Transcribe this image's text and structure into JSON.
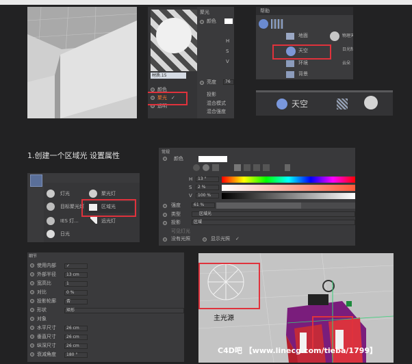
{
  "panel_viewport_1": {},
  "panel_material": {
    "name": "材质.15",
    "rows": [
      "颜色",
      "聚光",
      "透明"
    ],
    "checked": "✓"
  },
  "panel_light_props": {
    "title": "聚光",
    "color_label": "颜色",
    "h": "H",
    "s": "S",
    "v": "V",
    "brightness_label": "亮度",
    "brightness_value": "76",
    "project_label": "投影",
    "mix_label": "混合模式",
    "mix_strength": "混合强度"
  },
  "panel_menu": {
    "help": "帮助",
    "items": [
      "地面",
      "天空",
      "环境",
      "背景"
    ],
    "right_items": [
      "物理天空",
      "日光制工",
      "云朵"
    ]
  },
  "panel_sky_zoom": {
    "label": "天空"
  },
  "heading": "1.创建一个区域光 设置属性",
  "panel_light_menu": {
    "items": [
      "灯光",
      "目标聚光灯",
      "IES 灯...",
      "日光"
    ],
    "right_items": [
      "聚光灯",
      "区域光",
      "远光灯"
    ]
  },
  "panel_color_props": {
    "title": "常规",
    "color_label": "颜色",
    "h_label": "H",
    "h_value": "13 °",
    "s_label": "S",
    "s_value": "2 %",
    "v_label": "V",
    "v_value": "100 %",
    "brightness_label": "强度",
    "brightness_value": "61 %",
    "brightness_level": 0.61,
    "type_label": "类型",
    "type_value": "区域光",
    "shadow_label": "投影",
    "shadow_value": "区域",
    "visible_label": "可见灯光",
    "no_light_label": "没有光照",
    "show_light_label": "显示光照",
    "check": "✓"
  },
  "panel_detail": {
    "title": "细节",
    "rows": [
      {
        "label": "使用内部",
        "value": "✓"
      },
      {
        "label": "外部半径",
        "value": "13 cm"
      },
      {
        "label": "宽高比",
        "value": "1"
      },
      {
        "label": "对比",
        "value": "0 %"
      },
      {
        "label": "投影轮廓",
        "value": "否"
      },
      {
        "label": "形状",
        "value": "矩形"
      },
      {
        "label": "对象",
        "value": ""
      },
      {
        "label": "水平尺寸",
        "value": "26 cm"
      },
      {
        "label": "垂直尺寸",
        "value": "26 cm"
      },
      {
        "label": "纵深尺寸",
        "value": "26 cm"
      },
      {
        "label": "衰减角度",
        "value": "180 °"
      }
    ]
  },
  "panel_render": {
    "label": "主光源"
  },
  "watermark": "C4D吧 【www.linecg.com/tieba/1799】"
}
